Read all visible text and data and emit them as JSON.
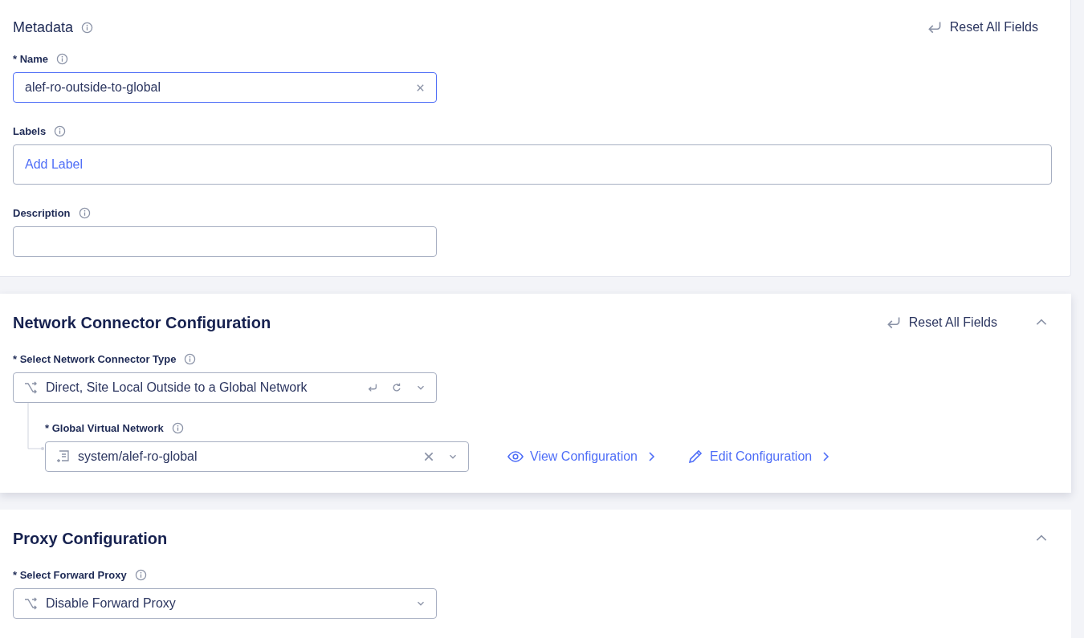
{
  "metadata": {
    "title": "Metadata",
    "reset_label": "Reset All Fields",
    "name_field": {
      "label": "* Name",
      "value": "alef-ro-outside-to-global",
      "focused": true
    },
    "labels_field": {
      "label": "Labels",
      "placeholder": "Add Label"
    },
    "description_field": {
      "label": "Description"
    }
  },
  "network_connector": {
    "title": "Network Connector Configuration",
    "reset_label": "Reset All Fields",
    "expanded": true,
    "type_field": {
      "label": "* Select Network Connector Type",
      "value": "Direct, Site Local Outside to a Global Network"
    },
    "global_network_field": {
      "label": "* Global Virtual Network",
      "value": "system/alef-ro-global"
    },
    "links": [
      {
        "kind": "view",
        "label": "View Configuration"
      },
      {
        "kind": "edit",
        "label": "Edit Configuration"
      }
    ]
  },
  "proxy": {
    "title": "Proxy Configuration",
    "expanded": true,
    "forward_proxy_field": {
      "label": "* Select Forward Proxy",
      "value": "Disable Forward Proxy"
    }
  }
}
